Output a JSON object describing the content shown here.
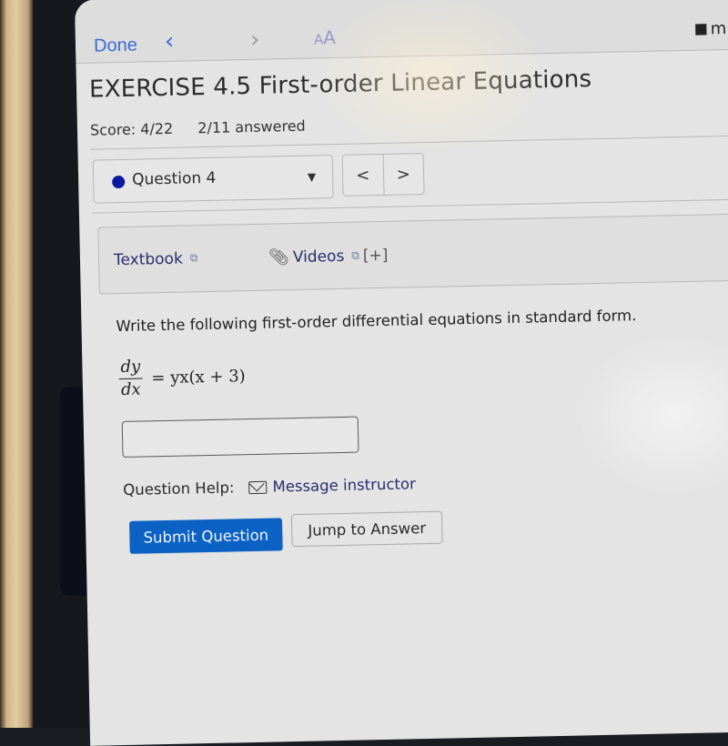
{
  "browser": {
    "done_label": "Done",
    "back_icon": "chevron-left",
    "forward_icon": "chevron-right",
    "text_size_small": "A",
    "text_size_large": "A",
    "url_partial": "m",
    "lock_icon": "🔒"
  },
  "header": {
    "title": "EXERCISE 4.5 First-order Linear Equations",
    "score": "Score: 4/22",
    "answered": "2/11 answered"
  },
  "question_nav": {
    "selected": "Question 4",
    "status_color": "#0a1aa0",
    "prev_label": "<",
    "next_label": ">"
  },
  "resources": {
    "textbook_label": "Textbook",
    "videos_label": "Videos",
    "expand_label": "[+]"
  },
  "question": {
    "prompt": "Write the following first-order differential equations in standard form.",
    "equation": {
      "numerator": "dy",
      "denominator": "dx",
      "rhs": "= yx(x + 3)"
    },
    "answer_value": "",
    "answer_placeholder": ""
  },
  "help": {
    "label": "Question Help:",
    "message_link": "Message instructor"
  },
  "actions": {
    "submit_label": "Submit Question",
    "jump_label": "Jump to Answer",
    "submit_color": "#0b62c4"
  }
}
